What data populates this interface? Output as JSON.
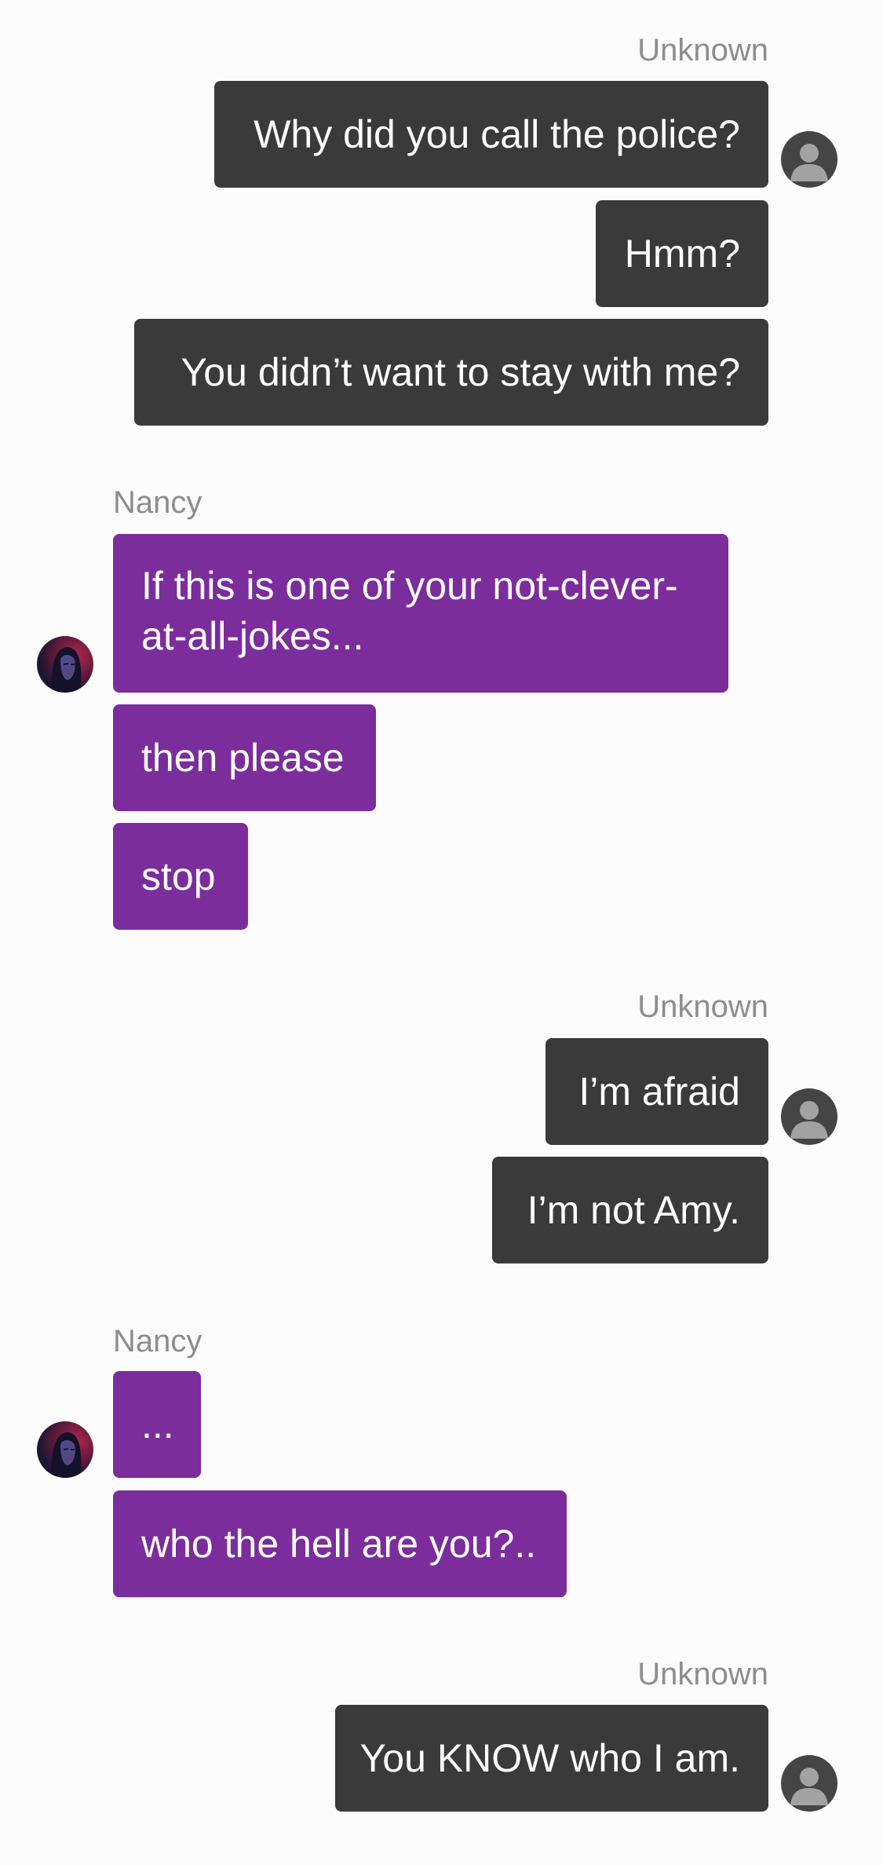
{
  "chat": {
    "groups": [
      {
        "sender": "Unknown",
        "side": "right",
        "messages": [
          "Why did you call the police?",
          "Hmm?",
          "You didn’t want to stay with me?"
        ]
      },
      {
        "sender": "Nancy",
        "side": "left",
        "messages": [
          "If this is one of your not-clever-at-all-jokes...",
          "then please",
          "stop"
        ]
      },
      {
        "sender": "Unknown",
        "side": "right",
        "messages": [
          "I’m afraid",
          "I’m not Amy."
        ]
      },
      {
        "sender": "Nancy",
        "side": "left",
        "messages": [
          "...",
          "who the hell are you?.."
        ]
      },
      {
        "sender": "Unknown",
        "side": "right",
        "messages": [
          "You KNOW who I am."
        ]
      }
    ]
  },
  "colors": {
    "outgoing_bubble": "#3a3a3a",
    "incoming_bubble": "#7b2d9c",
    "sender_name": "#8d8d8d",
    "background": "#fcfcfc"
  },
  "icons": {
    "unknown_avatar": "default-user-avatar-icon",
    "nancy_avatar": "nancy-portrait-avatar"
  }
}
